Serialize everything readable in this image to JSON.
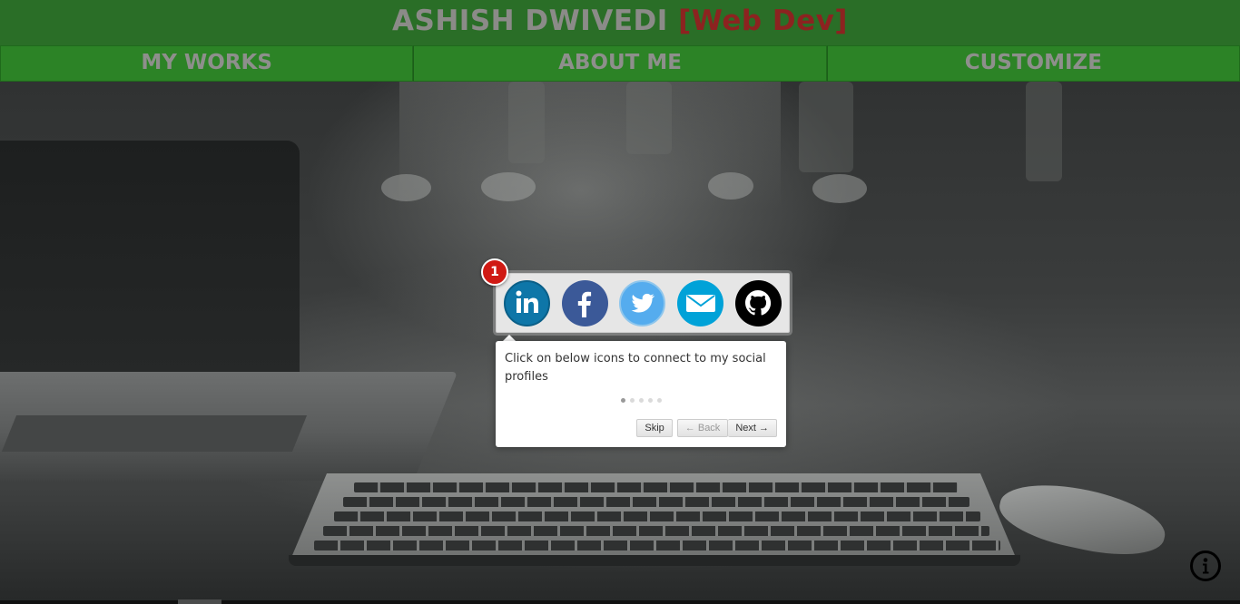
{
  "header": {
    "name": "ASHISH DWIVEDI",
    "role": "[Web Dev]"
  },
  "nav": {
    "items": [
      {
        "label": "MY WORKS"
      },
      {
        "label": "ABOUT ME"
      },
      {
        "label": "CUSTOMIZE"
      }
    ]
  },
  "tour": {
    "step_number": "1",
    "text": "Click on below icons to connect to my social profiles",
    "bullets_total": 5,
    "bullet_active": 1,
    "skip_label": "Skip",
    "back_label": "← Back",
    "next_label": "Next →"
  },
  "social": {
    "icons": [
      {
        "name": "linkedin-icon",
        "glyph": "in",
        "color": "#0e76a8"
      },
      {
        "name": "facebook-icon",
        "glyph": "f",
        "color": "#3b5998"
      },
      {
        "name": "twitter-icon",
        "glyph": "twitter-bird",
        "color": "#55acee"
      },
      {
        "name": "email-icon",
        "glyph": "envelope",
        "color": "#00a2d8"
      },
      {
        "name": "github-icon",
        "glyph": "octocat",
        "color": "#000000"
      }
    ]
  },
  "colors": {
    "header_bg": "#2a6e27",
    "nav_bg": "#2c8326",
    "title_color": "#8b8b88",
    "role_color": "#8c2320",
    "badge_red": "#d01a14"
  }
}
